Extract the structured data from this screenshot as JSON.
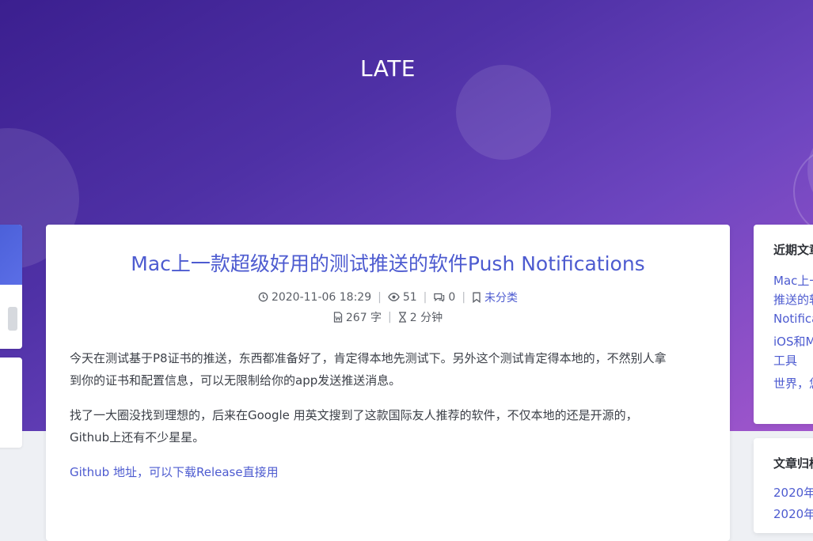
{
  "header": {
    "site_title": "LATE"
  },
  "post": {
    "title": "Mac上一款超级好用的测试推送的软件Push Notifications",
    "date": "2020-11-06 18:29",
    "views": "51",
    "comments": "0",
    "category": "未分类",
    "word_count": "267 字",
    "read_time": "2 分钟",
    "paragraph_1_line_1": "今天在测试基于P8证书的推送，东西都准备好了，肯定得本地先测试下。另外这个测试肯定得本地的，不然别人拿",
    "paragraph_1_line_2": "到你的证书和配置信息，可以无限制给你的app发送推送消息。",
    "paragraph_2_line_1": "找了一大圈没找到理想的，后来在Google 用英文搜到了这款国际友人推荐的软件，不仅本地的还是开源的，",
    "paragraph_2_line_2": "Github上还有不少星星。",
    "github_link": "Github 地址，可以下载Release直接用"
  },
  "sidebar_right": {
    "recent_title": "近期文章",
    "recent_items": [
      {
        "line1": "Mac上一",
        "line2": "推送的软",
        "line3": "Notifica"
      },
      {
        "line1": "iOS和M",
        "line2": "工具"
      },
      {
        "line1": "世界，您"
      }
    ],
    "archive_title": "文章归档",
    "archive_items": [
      "2020年",
      "2020年"
    ]
  },
  "colors": {
    "accent": "#4d5bd0",
    "hero_start": "#3b1f8f",
    "hero_end": "#a156cc",
    "background": "#eef0f4"
  },
  "icons": [
    "clock-icon",
    "eye-icon",
    "comment-icon",
    "bookmark-icon",
    "file-word-icon",
    "hourglass-icon"
  ]
}
